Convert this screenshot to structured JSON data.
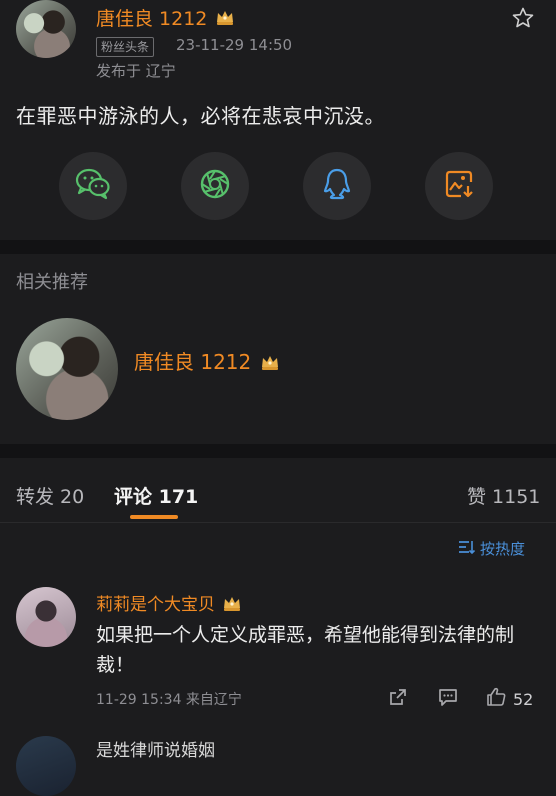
{
  "post": {
    "author": "唐佳良 1212",
    "badge": "粉丝头条",
    "timestamp": "23-11-29 14:50",
    "location": "发布于 辽宁",
    "content": "在罪恶中游泳的人，必将在悲哀中沉没。"
  },
  "share": {
    "icons": [
      "wechat-icon",
      "moments-icon",
      "qq-icon",
      "save-image-icon"
    ]
  },
  "related": {
    "title": "相关推荐",
    "user_name": "唐佳良 1212"
  },
  "tabs": {
    "repost": "转发 20",
    "comments": "评论 171",
    "likes": "赞 1151"
  },
  "sort": {
    "label": "按热度"
  },
  "comments": [
    {
      "author": "莉莉是个大宝贝",
      "text": "如果把一个人定义成罪恶，希望他能得到法律的制裁！",
      "meta": "11-29 15:34 来自辽宁",
      "likes": "52"
    },
    {
      "author": "",
      "text": "是姓律师说婚姻"
    }
  ],
  "colors": {
    "accent": "#f08a24",
    "background": "#1c1c1e",
    "separator": "#121214"
  }
}
